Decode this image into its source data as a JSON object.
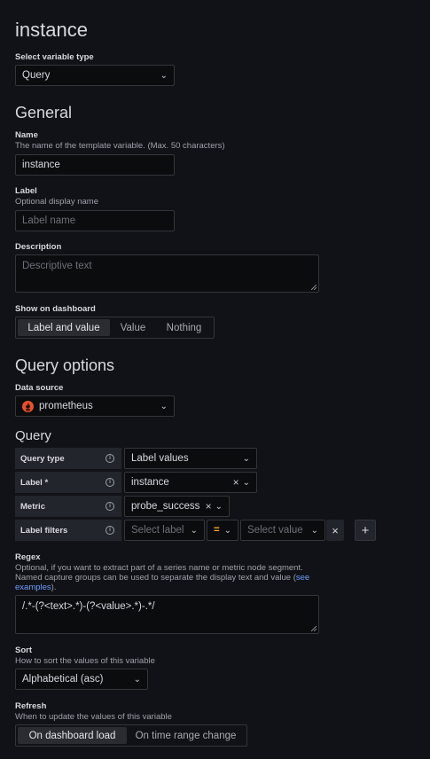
{
  "title": "instance",
  "variable_type": {
    "label": "Select variable type",
    "value": "Query"
  },
  "general": {
    "heading": "General",
    "name": {
      "label": "Name",
      "description": "The name of the template variable. (Max. 50 characters)",
      "value": "instance"
    },
    "label": {
      "label": "Label",
      "description": "Optional display name",
      "placeholder": "Label name"
    },
    "description": {
      "label": "Description",
      "placeholder": "Descriptive text"
    },
    "show_on_dashboard": {
      "label": "Show on dashboard",
      "options": [
        "Label and value",
        "Value",
        "Nothing"
      ],
      "selected": "Label and value"
    }
  },
  "query_options": {
    "heading": "Query options",
    "data_source": {
      "label": "Data source",
      "value": "prometheus"
    },
    "query": {
      "heading": "Query",
      "query_type": {
        "label": "Query type",
        "value": "Label values"
      },
      "label_row": {
        "label": "Label *",
        "value": "instance"
      },
      "metric": {
        "label": "Metric",
        "value": "probe_success"
      },
      "label_filters": {
        "label": "Label filters",
        "label_placeholder": "Select label",
        "operator": "=",
        "value_placeholder": "Select value"
      }
    },
    "regex": {
      "label": "Regex",
      "description_1": "Optional, if you want to extract part of a series name or metric node segment.",
      "description_2": "Named capture groups can be used to separate the display text and value (",
      "link_see": "see",
      "link_examples": "examples",
      "description_end": ").",
      "value": "/.*-(?<text>.*)-(?<value>.*)-.*/"
    },
    "sort": {
      "label": "Sort",
      "description": "How to sort the values of this variable",
      "value": "Alphabetical (asc)"
    },
    "refresh": {
      "label": "Refresh",
      "description": "When to update the values of this variable",
      "options": [
        "On dashboard load",
        "On time range change"
      ],
      "selected": "On dashboard load"
    }
  },
  "icons": {
    "chevron": "chevron-down-icon",
    "info": "info-icon",
    "clear": "close-icon",
    "add": "plus-icon",
    "datasource": "prometheus-logo"
  }
}
